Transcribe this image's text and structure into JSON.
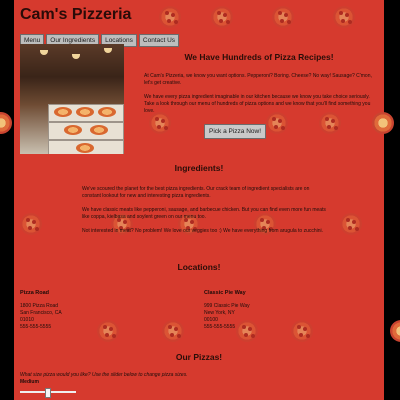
{
  "site": {
    "title": "Cam's Pizzeria"
  },
  "nav": {
    "items": [
      {
        "label": "Menu"
      },
      {
        "label": "Our Ingredients"
      },
      {
        "label": "Locations"
      },
      {
        "label": "Contact Us"
      }
    ]
  },
  "recipes": {
    "heading": "We Have Hundreds of Pizza Recipes!",
    "p1": "At Cam's Pizzeria, we know you want options. Pepperoni? Boring. Cheese? No way! Sausage? C'mon, let's get creative.",
    "p2": "We have every pizza ingredient imaginable in our kitchen because we know you take choice seriously. Take a look through our menu of hundreds of pizza options and we know that you'll find something you love.",
    "button": "Pick a Pizza Now!"
  },
  "ingredients": {
    "heading": "Ingredients!",
    "p1": "We've scoured the planet for the best pizza ingredients. Our crack team of ingredient specialists are on constant lookout for new and interesting pizza ingredients.",
    "p2": "We have classic meats like pepperoni, sausage, and barbecue chicken. But you can find even more fun meats like coppa, kielbasa and soylent green on our menu too.",
    "p3": "Not interested in meat? No problem! We love our veggies too :) We have everything from arugula to zucchini."
  },
  "locations": {
    "heading": "Locations!",
    "list": [
      {
        "name": "Pizza Road",
        "street": "1800 Pizza Road",
        "city": "San Francisco, CA",
        "zip": "01010",
        "phone": "555-555-5555"
      },
      {
        "name": "Classic Pie Way",
        "street": "999 Classic Pie Way",
        "city": "New York, NY",
        "zip": "00100",
        "phone": "555-555-5555"
      }
    ]
  },
  "pizzas": {
    "heading": "Our Pizzas!",
    "prompt": "What size pizza would you like? Use the slider below to change pizza sizes.",
    "size": "Medium",
    "slider_level": 0.5
  },
  "icons": {
    "background": "pizza-icon"
  },
  "colors": {
    "page_bg": "#d63a2e",
    "outer_bg": "#000000"
  }
}
